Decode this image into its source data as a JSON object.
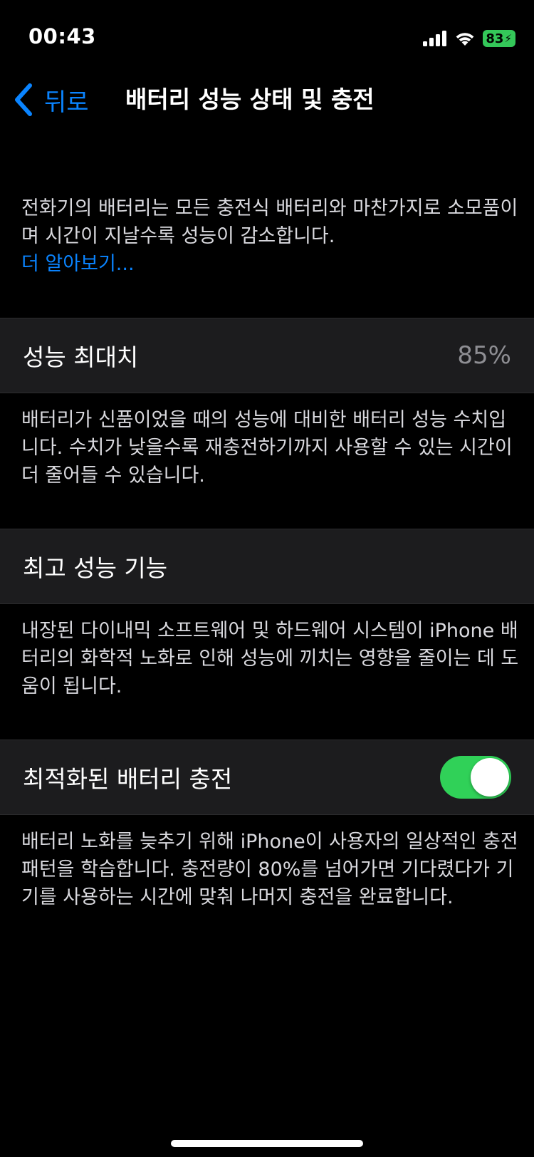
{
  "status_bar": {
    "time": "00:43",
    "battery_percent": "83",
    "battery_charging": true,
    "battery_color": "#34c759"
  },
  "nav": {
    "back_label": "뒤로",
    "title": "배터리 성능 상태 및 충전",
    "accent_color": "#0a84ff"
  },
  "intro": {
    "text": "전화기의 배터리는 모든 충전식 배터리와 마찬가지로 소모품이며 시간이 지날수록 성능이 감소합니다.",
    "learn_more": "더 알아보기..."
  },
  "maximum_capacity": {
    "label": "성능 최대치",
    "value": "85%",
    "description": "배터리가 신품이었을 때의 성능에 대비한 배터리 성능 수치입니다. 수치가 낮을수록 재충전하기까지 사용할 수 있는 시간이 더 줄어들 수 있습니다."
  },
  "peak_performance": {
    "label": "최고 성능 기능",
    "description": "내장된 다이내믹 소프트웨어 및 하드웨어 시스템이 iPhone 배터리의 화학적 노화로 인해 성능에 끼치는 영향을 줄이는 데 도움이 됩니다."
  },
  "optimized_charging": {
    "label": "최적화된 배터리 충전",
    "enabled": true,
    "toggle_color": "#30d158",
    "description": "배터리 노화를 늦추기 위해 iPhone이 사용자의 일상적인 충전 패턴을 학습합니다. 충전량이 80%를 넘어가면 기다렸다가 기기를 사용하는 시간에 맞춰 나머지 충전을 완료합니다."
  },
  "icons": {
    "back": "chevron-left-icon",
    "signal": "cellular-signal-icon",
    "wifi": "wifi-icon",
    "battery": "battery-icon"
  }
}
